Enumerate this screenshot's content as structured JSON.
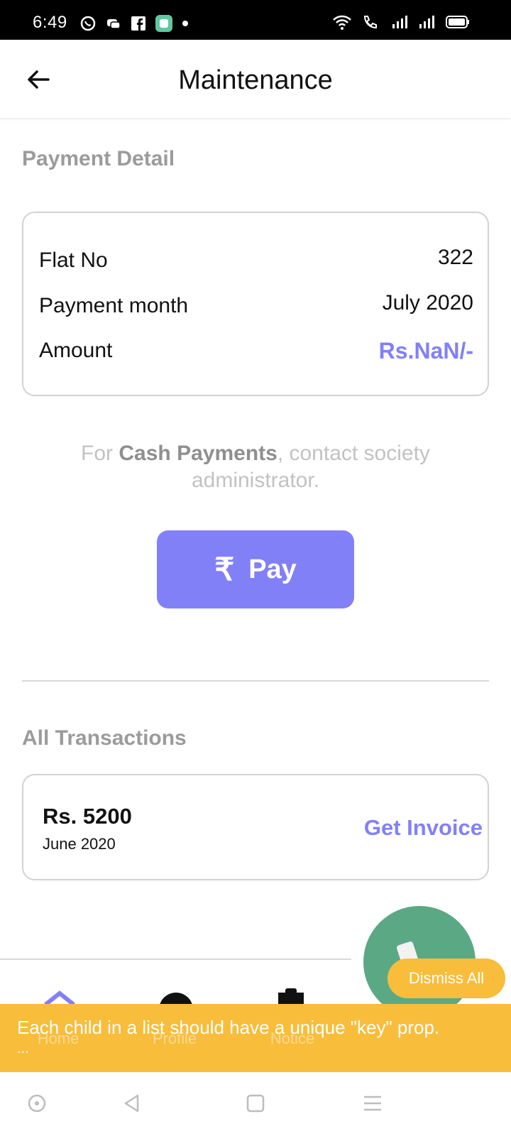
{
  "status_bar": {
    "time": "6:49"
  },
  "app_bar": {
    "title": "Maintenance",
    "back_icon": "arrow-left-icon"
  },
  "payment_detail": {
    "section_title": "Payment Detail",
    "rows": [
      {
        "label": "Flat No",
        "value": "322"
      },
      {
        "label": "Payment month",
        "value": "July 2020"
      },
      {
        "label": "Amount",
        "value": "Rs.NaN/-"
      }
    ]
  },
  "cash_note": {
    "prefix": "For ",
    "bold": "Cash Payments",
    "suffix": ", contact society administrator."
  },
  "pay_button": {
    "symbol": "₹",
    "label": "Pay"
  },
  "transactions": {
    "section_title": "All Transactions",
    "items": [
      {
        "amount": "Rs. 5200",
        "month": "June 2020",
        "action": "Get Invoice"
      }
    ]
  },
  "bottom_nav": {
    "items": [
      {
        "label": "Home",
        "icon": "home-icon"
      },
      {
        "label": "Profile",
        "icon": "profile-icon"
      },
      {
        "label": "Notice",
        "icon": "clipboard-icon"
      }
    ]
  },
  "dismiss_button": {
    "label": "Dismiss All"
  },
  "toast": {
    "message": "Each child in a list should have a unique \"key\" prop.",
    "more": "..."
  },
  "colors": {
    "accent": "#8280f7",
    "toast": "#f8bd3a",
    "fab": "#5aa984"
  }
}
